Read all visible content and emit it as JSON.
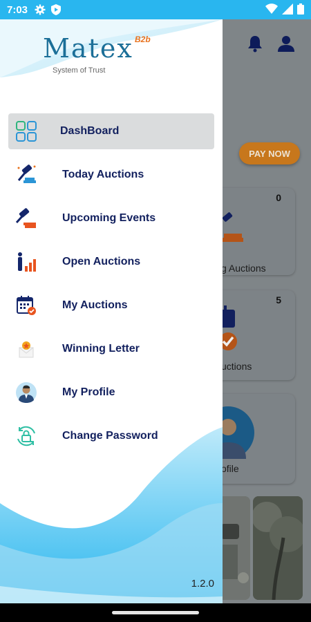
{
  "status_bar": {
    "time": "7:03"
  },
  "app": {
    "pay_now": "PAY NOW",
    "cards": [
      {
        "count": "0",
        "label": "g Auctions"
      },
      {
        "count": "5",
        "label": "uctions"
      },
      {
        "count": "",
        "label": "ofile"
      }
    ]
  },
  "drawer": {
    "logo": {
      "name": "Matex",
      "suffix": "B2b",
      "tagline": "System of Trust"
    },
    "menu": [
      {
        "label": "DashBoard",
        "icon": "dashboard-icon",
        "active": true
      },
      {
        "label": "Today Auctions",
        "icon": "gavel-icon"
      },
      {
        "label": "Upcoming Events",
        "icon": "upcoming-gavel-icon"
      },
      {
        "label": "Open Auctions",
        "icon": "bar-chart-person-icon"
      },
      {
        "label": "My Auctions",
        "icon": "calendar-check-icon"
      },
      {
        "label": "Winning Letter",
        "icon": "award-letter-icon"
      },
      {
        "label": "My Profile",
        "icon": "profile-avatar-icon"
      },
      {
        "label": "Change Password",
        "icon": "lock-refresh-icon"
      }
    ],
    "version": "1.2.0"
  },
  "colors": {
    "status_bar": "#29b6ef",
    "menu_text": "#12205e",
    "active_bg": "#dadcdd",
    "pay_now": "#c7771c"
  }
}
